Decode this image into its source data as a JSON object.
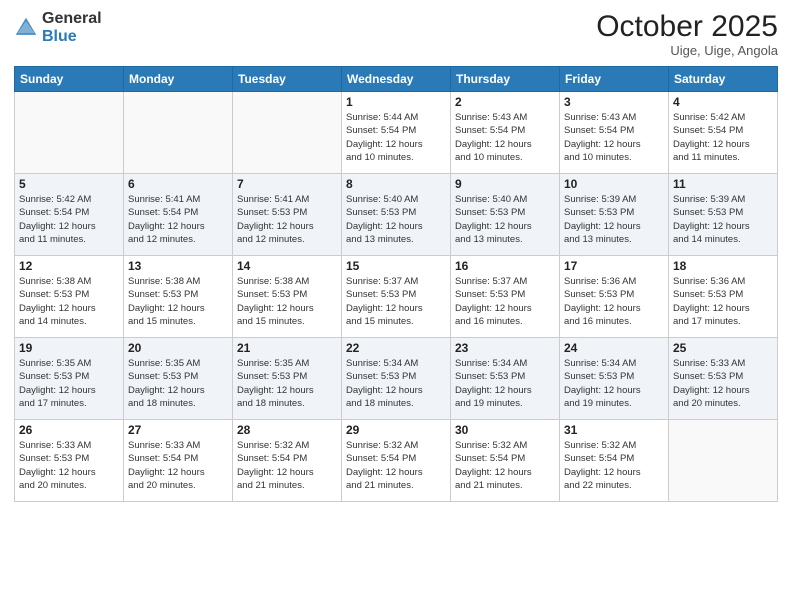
{
  "header": {
    "logo_general": "General",
    "logo_blue": "Blue",
    "month_title": "October 2025",
    "location": "Uige, Uige, Angola"
  },
  "weekdays": [
    "Sunday",
    "Monday",
    "Tuesday",
    "Wednesday",
    "Thursday",
    "Friday",
    "Saturday"
  ],
  "weeks": [
    [
      {
        "day": "",
        "info": ""
      },
      {
        "day": "",
        "info": ""
      },
      {
        "day": "",
        "info": ""
      },
      {
        "day": "1",
        "info": "Sunrise: 5:44 AM\nSunset: 5:54 PM\nDaylight: 12 hours\nand 10 minutes."
      },
      {
        "day": "2",
        "info": "Sunrise: 5:43 AM\nSunset: 5:54 PM\nDaylight: 12 hours\nand 10 minutes."
      },
      {
        "day": "3",
        "info": "Sunrise: 5:43 AM\nSunset: 5:54 PM\nDaylight: 12 hours\nand 10 minutes."
      },
      {
        "day": "4",
        "info": "Sunrise: 5:42 AM\nSunset: 5:54 PM\nDaylight: 12 hours\nand 11 minutes."
      }
    ],
    [
      {
        "day": "5",
        "info": "Sunrise: 5:42 AM\nSunset: 5:54 PM\nDaylight: 12 hours\nand 11 minutes."
      },
      {
        "day": "6",
        "info": "Sunrise: 5:41 AM\nSunset: 5:54 PM\nDaylight: 12 hours\nand 12 minutes."
      },
      {
        "day": "7",
        "info": "Sunrise: 5:41 AM\nSunset: 5:53 PM\nDaylight: 12 hours\nand 12 minutes."
      },
      {
        "day": "8",
        "info": "Sunrise: 5:40 AM\nSunset: 5:53 PM\nDaylight: 12 hours\nand 13 minutes."
      },
      {
        "day": "9",
        "info": "Sunrise: 5:40 AM\nSunset: 5:53 PM\nDaylight: 12 hours\nand 13 minutes."
      },
      {
        "day": "10",
        "info": "Sunrise: 5:39 AM\nSunset: 5:53 PM\nDaylight: 12 hours\nand 13 minutes."
      },
      {
        "day": "11",
        "info": "Sunrise: 5:39 AM\nSunset: 5:53 PM\nDaylight: 12 hours\nand 14 minutes."
      }
    ],
    [
      {
        "day": "12",
        "info": "Sunrise: 5:38 AM\nSunset: 5:53 PM\nDaylight: 12 hours\nand 14 minutes."
      },
      {
        "day": "13",
        "info": "Sunrise: 5:38 AM\nSunset: 5:53 PM\nDaylight: 12 hours\nand 15 minutes."
      },
      {
        "day": "14",
        "info": "Sunrise: 5:38 AM\nSunset: 5:53 PM\nDaylight: 12 hours\nand 15 minutes."
      },
      {
        "day": "15",
        "info": "Sunrise: 5:37 AM\nSunset: 5:53 PM\nDaylight: 12 hours\nand 15 minutes."
      },
      {
        "day": "16",
        "info": "Sunrise: 5:37 AM\nSunset: 5:53 PM\nDaylight: 12 hours\nand 16 minutes."
      },
      {
        "day": "17",
        "info": "Sunrise: 5:36 AM\nSunset: 5:53 PM\nDaylight: 12 hours\nand 16 minutes."
      },
      {
        "day": "18",
        "info": "Sunrise: 5:36 AM\nSunset: 5:53 PM\nDaylight: 12 hours\nand 17 minutes."
      }
    ],
    [
      {
        "day": "19",
        "info": "Sunrise: 5:35 AM\nSunset: 5:53 PM\nDaylight: 12 hours\nand 17 minutes."
      },
      {
        "day": "20",
        "info": "Sunrise: 5:35 AM\nSunset: 5:53 PM\nDaylight: 12 hours\nand 18 minutes."
      },
      {
        "day": "21",
        "info": "Sunrise: 5:35 AM\nSunset: 5:53 PM\nDaylight: 12 hours\nand 18 minutes."
      },
      {
        "day": "22",
        "info": "Sunrise: 5:34 AM\nSunset: 5:53 PM\nDaylight: 12 hours\nand 18 minutes."
      },
      {
        "day": "23",
        "info": "Sunrise: 5:34 AM\nSunset: 5:53 PM\nDaylight: 12 hours\nand 19 minutes."
      },
      {
        "day": "24",
        "info": "Sunrise: 5:34 AM\nSunset: 5:53 PM\nDaylight: 12 hours\nand 19 minutes."
      },
      {
        "day": "25",
        "info": "Sunrise: 5:33 AM\nSunset: 5:53 PM\nDaylight: 12 hours\nand 20 minutes."
      }
    ],
    [
      {
        "day": "26",
        "info": "Sunrise: 5:33 AM\nSunset: 5:53 PM\nDaylight: 12 hours\nand 20 minutes."
      },
      {
        "day": "27",
        "info": "Sunrise: 5:33 AM\nSunset: 5:54 PM\nDaylight: 12 hours\nand 20 minutes."
      },
      {
        "day": "28",
        "info": "Sunrise: 5:32 AM\nSunset: 5:54 PM\nDaylight: 12 hours\nand 21 minutes."
      },
      {
        "day": "29",
        "info": "Sunrise: 5:32 AM\nSunset: 5:54 PM\nDaylight: 12 hours\nand 21 minutes."
      },
      {
        "day": "30",
        "info": "Sunrise: 5:32 AM\nSunset: 5:54 PM\nDaylight: 12 hours\nand 21 minutes."
      },
      {
        "day": "31",
        "info": "Sunrise: 5:32 AM\nSunset: 5:54 PM\nDaylight: 12 hours\nand 22 minutes."
      },
      {
        "day": "",
        "info": ""
      }
    ]
  ]
}
